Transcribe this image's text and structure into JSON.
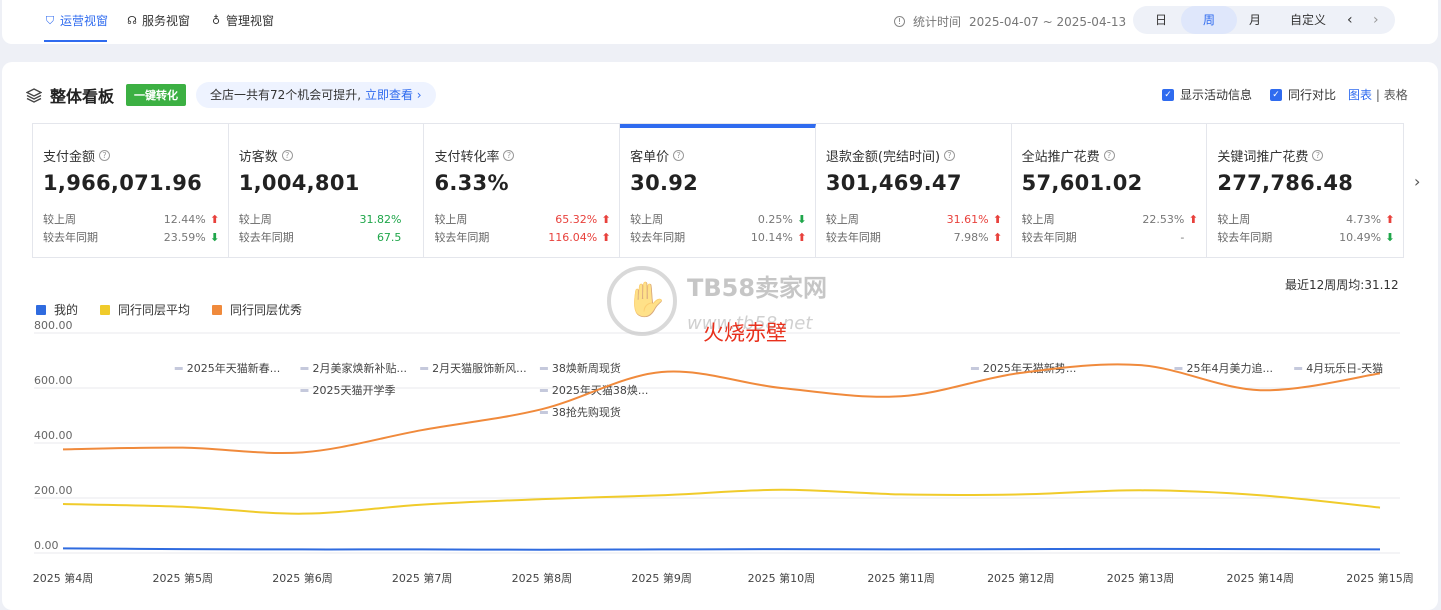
{
  "topbar": {
    "tabs": [
      {
        "label": "运营视窗",
        "active": true,
        "icon": "shield-icon"
      },
      {
        "label": "服务视窗",
        "active": false,
        "icon": "headset-icon"
      },
      {
        "label": "管理视窗",
        "active": false,
        "icon": "medal-icon"
      }
    ],
    "stat_label": "统计时间",
    "stat_range": "2025-04-07 ~ 2025-04-13",
    "periods": [
      "日",
      "周",
      "月",
      "自定义"
    ],
    "active_period": "周"
  },
  "board": {
    "title": "整体看板",
    "one_click": "一键转化",
    "opportunity_text": "全店一共有72个机会可提升,",
    "opportunity_link": "立即查看",
    "show_activity": "显示活动信息",
    "peer_compare": "同行对比",
    "view_chart": "图表",
    "view_sep": "|",
    "view_table": "表格"
  },
  "compare_labels": {
    "wow": "较上周",
    "yoy": "较去年同期"
  },
  "metrics": [
    {
      "label": "支付金额",
      "value": "1,966,071.96",
      "wow": "12.44%",
      "wow_dir": "up",
      "yoy": "23.59%",
      "yoy_dir": "down"
    },
    {
      "label": "访客数",
      "value": "1,004,801",
      "wow": "31.82%",
      "wow_dir": "green",
      "yoy": "67.5",
      "yoy_dir": "green"
    },
    {
      "label": "支付转化率",
      "value": "6.33%",
      "wow": "65.32%",
      "wow_dir": "up-red",
      "yoy": "116.04%",
      "yoy_dir": "up-red"
    },
    {
      "label": "客单价",
      "value": "30.92",
      "wow": "0.25%",
      "wow_dir": "down",
      "yoy": "10.14%",
      "yoy_dir": "up"
    },
    {
      "label": "退款金额(完结时间)",
      "value": "301,469.47",
      "wow": "31.61%",
      "wow_dir": "up-red",
      "yoy": "7.98%",
      "yoy_dir": "up"
    },
    {
      "label": "全站推广花费",
      "value": "57,601.02",
      "wow": "22.53%",
      "wow_dir": "up",
      "yoy": "-",
      "yoy_dir": "none"
    },
    {
      "label": "关键词推广花费",
      "value": "277,786.48",
      "wow": "4.73%",
      "wow_dir": "up",
      "yoy": "10.49%",
      "yoy_dir": "down"
    }
  ],
  "chart_summary": "最近12周周均:31.12",
  "chart_data": {
    "type": "line",
    "categories": [
      "2025 第4周",
      "2025 第5周",
      "2025 第6周",
      "2025 第7周",
      "2025 第8周",
      "2025 第9周",
      "2025 第10周",
      "2025 第11周",
      "2025 第12周",
      "2025 第13周",
      "2025 第14周",
      "2025 第15周"
    ],
    "ylim": [
      0,
      800
    ],
    "yticks": [
      "0.00",
      "200.00",
      "400.00",
      "600.00",
      "800.00"
    ],
    "series": [
      {
        "name": "我的",
        "color": "#2f6bdf",
        "values": [
          17,
          14,
          13,
          13,
          12,
          13,
          14,
          13,
          14,
          15,
          14,
          13
        ]
      },
      {
        "name": "同行同层平均",
        "color": "#f0cb2b",
        "values": [
          178,
          168,
          143,
          176,
          196,
          210,
          230,
          213,
          213,
          228,
          210,
          165
        ]
      },
      {
        "name": "同行同层优秀",
        "color": "#f08a3c",
        "values": [
          377,
          383,
          366,
          447,
          523,
          658,
          600,
          570,
          655,
          683,
          592,
          653
        ]
      }
    ],
    "annotations": [
      {
        "label": "2025年天猫新春...",
        "row": 0,
        "at": 0.95
      },
      {
        "label": "2月美家焕新补贴...",
        "row": 0,
        "at": 2.0
      },
      {
        "label": "2025天猫开学季",
        "row": 1,
        "at": 2.0
      },
      {
        "label": "2月天猫服饰新风...",
        "row": 0,
        "at": 3.0
      },
      {
        "label": "38焕新周现货",
        "row": 0,
        "at": 4.0
      },
      {
        "label": "2025年天猫38焕...",
        "row": 1,
        "at": 4.0
      },
      {
        "label": "38抢先购现货",
        "row": 2,
        "at": 4.0
      },
      {
        "label": "2025年天猫新势...",
        "row": 0,
        "at": 7.6
      },
      {
        "label": "25年4月美力追...",
        "row": 0,
        "at": 9.3
      },
      {
        "label": "4月玩乐日-天猫",
        "row": 0,
        "at": 10.3
      }
    ]
  },
  "watermark": {
    "brand": "TB58卖家网",
    "url": "www.tb58.net"
  },
  "overlay_text": "火烧赤壁"
}
